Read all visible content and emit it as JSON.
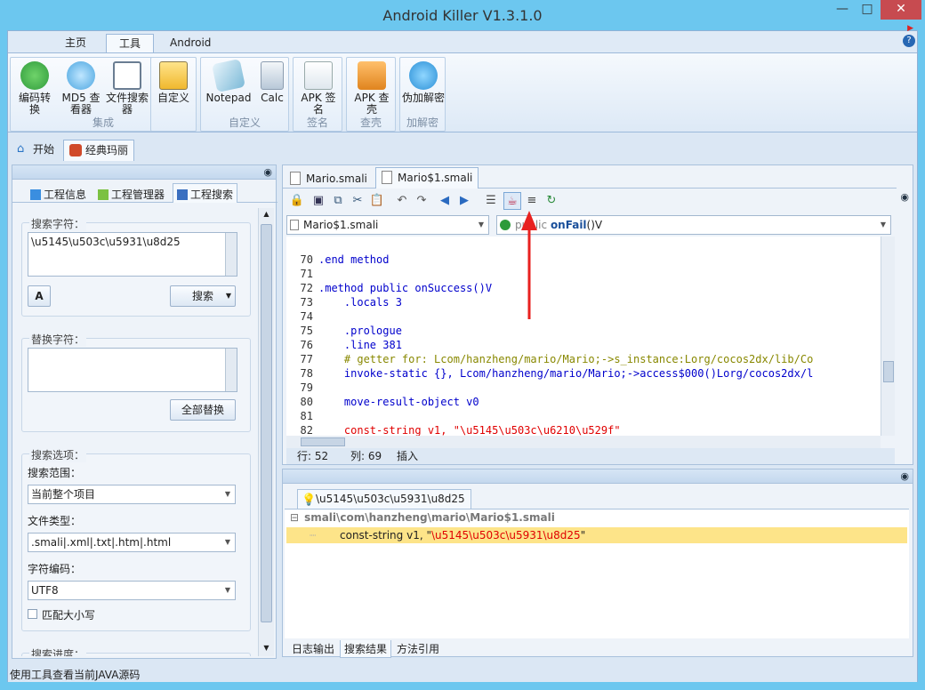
{
  "window": {
    "title": "Android Killer V1.3.1.0"
  },
  "ribbon": {
    "tabs": [
      "主页",
      "工具",
      "Android"
    ],
    "groups": [
      {
        "name": "集成",
        "buttons": [
          "编码转换",
          "MD5 查看器",
          "文件搜索器"
        ]
      },
      {
        "name": "",
        "buttons": [
          "自定义"
        ]
      },
      {
        "name": "自定义",
        "buttons": [
          "Notepad",
          "Calc"
        ]
      },
      {
        "name": "签名",
        "buttons": [
          "APK 签名"
        ]
      },
      {
        "name": "查壳",
        "buttons": [
          "APK 查壳"
        ]
      },
      {
        "name": "加解密",
        "buttons": [
          "伪加解密"
        ]
      }
    ]
  },
  "doc_tabs": [
    "开始",
    "经典玛丽"
  ],
  "left": {
    "tabs": [
      "工程信息",
      "工程管理器",
      "工程搜索"
    ],
    "search_label": "搜索字符：",
    "search_value": "\\u5145\\u503c\\u5931\\u8d25",
    "search_button": "搜索",
    "replace_label": "替换字符：",
    "replace_value": "",
    "replace_all_button": "全部替换",
    "options_label": "搜索选项：",
    "scope_label": "搜索范围：",
    "scope_value": "当前整个项目",
    "filetype_label": "文件类型：",
    "filetype_value": ".smali|.xml|.txt|.htm|.html",
    "encoding_label": "字符编码：",
    "encoding_value": "UTF8",
    "match_case_label": "匹配大小写",
    "progress_label": "搜索进度："
  },
  "editor": {
    "file_tabs": [
      "Mario.smali",
      "Mario$1.smali"
    ],
    "class_combo": "Mario$1.smali",
    "method_combo": {
      "public_kw": "public",
      "name": "onFail",
      "sig": "()V"
    },
    "lines": [
      {
        "n": "70",
        "text": ".end method"
      },
      {
        "n": "71",
        "text": ""
      },
      {
        "n": "72",
        "text": ".method public onSuccess()V"
      },
      {
        "n": "73",
        "text": "    .locals 3"
      },
      {
        "n": "74",
        "text": ""
      },
      {
        "n": "75",
        "text": "    .prologue"
      },
      {
        "n": "76",
        "text": "    .line 381"
      },
      {
        "n": "77",
        "text": "    # getter for: Lcom/hanzheng/mario/Mario;->s_instance:Lorg/cocos2dx/lib/Co"
      },
      {
        "n": "78",
        "text": "    invoke-static {}, Lcom/hanzheng/mario/Mario;->access$000()Lorg/cocos2dx/l"
      },
      {
        "n": "79",
        "text": ""
      },
      {
        "n": "80",
        "text": "    move-result-object v0"
      },
      {
        "n": "81",
        "text": ""
      },
      {
        "n": "82",
        "text": "    const-string v1, \"\\u5145\\u503c\\u6210\\u529f\""
      }
    ],
    "status": {
      "row": "行: 52",
      "col": "列: 69",
      "mode": "插入"
    }
  },
  "results": {
    "tab": "\\u5145\\u503c\\u5931\\u8d25",
    "file": "smali\\com\\hanzheng\\mario\\Mario$1.smali",
    "match_prefix": "const-string v1, \"",
    "match_value": "\\u5145\\u503c\\u5931\\u8d25",
    "match_suffix": "\""
  },
  "bottom_tabs": [
    "日志输出",
    "搜索结果",
    "方法引用"
  ],
  "statusbar": "使用工具查看当前JAVA源码"
}
